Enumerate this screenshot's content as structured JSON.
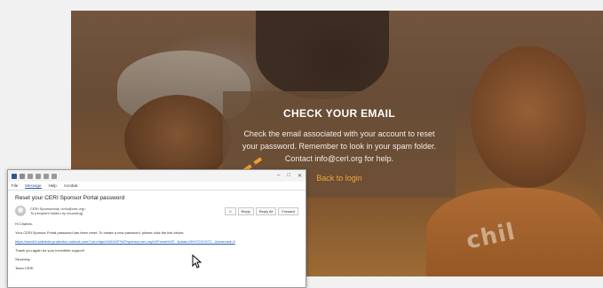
{
  "hero": {
    "shirt_text": "chil"
  },
  "card": {
    "title": "CHECK YOUR EMAIL",
    "message": "Check the email associated with your account to reset your password. Remember to look in your spam folder. Contact info@cerl.org for help.",
    "back_link": "Back to login",
    "accent_color": "#f0a33e"
  },
  "mail": {
    "ribbon": [
      "File",
      "Message",
      "Help",
      "Acrobat"
    ],
    "active_tab": "Message",
    "subject": "Reset your CERI Sponsor Portal password",
    "sender": "CERI Sponsorship <info@cerl.org>",
    "to": "To  [recipient hidden by recording]",
    "actions": [
      "Reply",
      "Reply All",
      "Forward"
    ],
    "greeting": "Hi Charles,",
    "line1": "Your CERI Sponsor Portal password has been reset. To create a new password, please click the link below:",
    "url": "https://nam04.safelinks.protection.outlook.com/?url=https%3A%2F%2Fsponsor.cerl.org%2Freset%2F...&data=05%7C01%7C...&reserved=0",
    "thanks": "Thank you again for your incredible support!",
    "signoff": "Sincerely,",
    "signature": "Team CERI"
  }
}
